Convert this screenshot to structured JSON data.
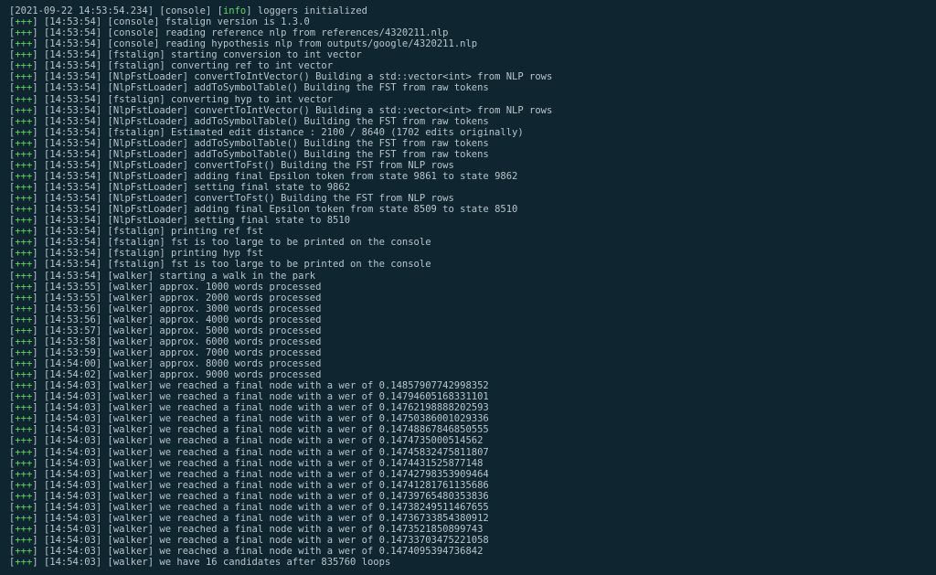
{
  "plus": "+++",
  "info": "info",
  "lines": [
    {
      "p": false,
      "ts": "[2021-09-22 14:53:54.234]",
      "tag": "[console]",
      "msg": "loggers initialized",
      "hasInfo": true
    },
    {
      "p": true,
      "ts": "[14:53:54]",
      "tag": "[console]",
      "msg": "fstalign version is 1.3.0"
    },
    {
      "p": true,
      "ts": "[14:53:54]",
      "tag": "[console]",
      "msg": "reading reference nlp from references/4320211.nlp"
    },
    {
      "p": true,
      "ts": "[14:53:54]",
      "tag": "[console]",
      "msg": "reading hypothesis nlp from outputs/google/4320211.nlp"
    },
    {
      "p": true,
      "ts": "[14:53:54]",
      "tag": "[fstalign]",
      "msg": "starting conversion to int vector"
    },
    {
      "p": true,
      "ts": "[14:53:54]",
      "tag": "[fstalign]",
      "msg": "converting ref to int vector"
    },
    {
      "p": true,
      "ts": "[14:53:54]",
      "tag": "[NlpFstLoader]",
      "msg": "convertToIntVector() Building a std::vector<int> from NLP rows"
    },
    {
      "p": true,
      "ts": "[14:53:54]",
      "tag": "[NlpFstLoader]",
      "msg": "addToSymbolTable() Building the FST from raw tokens"
    },
    {
      "p": true,
      "ts": "[14:53:54]",
      "tag": "[fstalign]",
      "msg": "converting hyp to int vector"
    },
    {
      "p": true,
      "ts": "[14:53:54]",
      "tag": "[NlpFstLoader]",
      "msg": "convertToIntVector() Building a std::vector<int> from NLP rows"
    },
    {
      "p": true,
      "ts": "[14:53:54]",
      "tag": "[NlpFstLoader]",
      "msg": "addToSymbolTable() Building the FST from raw tokens"
    },
    {
      "p": true,
      "ts": "[14:53:54]",
      "tag": "[fstalign]",
      "msg": "Estimated edit distance : 2100 / 8640 (1702 edits originally)"
    },
    {
      "p": true,
      "ts": "[14:53:54]",
      "tag": "[NlpFstLoader]",
      "msg": "addToSymbolTable() Building the FST from raw tokens"
    },
    {
      "p": true,
      "ts": "[14:53:54]",
      "tag": "[NlpFstLoader]",
      "msg": "addToSymbolTable() Building the FST from raw tokens"
    },
    {
      "p": true,
      "ts": "[14:53:54]",
      "tag": "[NlpFstLoader]",
      "msg": "convertToFst() Building the FST from NLP rows"
    },
    {
      "p": true,
      "ts": "[14:53:54]",
      "tag": "[NlpFstLoader]",
      "msg": "adding final Epsilon token from state 9861 to state 9862"
    },
    {
      "p": true,
      "ts": "[14:53:54]",
      "tag": "[NlpFstLoader]",
      "msg": "setting final state to 9862"
    },
    {
      "p": true,
      "ts": "[14:53:54]",
      "tag": "[NlpFstLoader]",
      "msg": "convertToFst() Building the FST from NLP rows"
    },
    {
      "p": true,
      "ts": "[14:53:54]",
      "tag": "[NlpFstLoader]",
      "msg": "adding final Epsilon token from state 8509 to state 8510"
    },
    {
      "p": true,
      "ts": "[14:53:54]",
      "tag": "[NlpFstLoader]",
      "msg": "setting final state to 8510"
    },
    {
      "p": true,
      "ts": "[14:53:54]",
      "tag": "[fstalign]",
      "msg": "printing ref fst"
    },
    {
      "p": true,
      "ts": "[14:53:54]",
      "tag": "[fstalign]",
      "msg": "fst is too large to be printed on the console"
    },
    {
      "p": true,
      "ts": "[14:53:54]",
      "tag": "[fstalign]",
      "msg": "printing hyp fst"
    },
    {
      "p": true,
      "ts": "[14:53:54]",
      "tag": "[fstalign]",
      "msg": "fst is too large to be printed on the console"
    },
    {
      "p": true,
      "ts": "[14:53:54]",
      "tag": "[walker]",
      "msg": "starting a walk in the park"
    },
    {
      "p": true,
      "ts": "[14:53:55]",
      "tag": "[walker]",
      "msg": "approx. 1000 words processed"
    },
    {
      "p": true,
      "ts": "[14:53:55]",
      "tag": "[walker]",
      "msg": "approx. 2000 words processed"
    },
    {
      "p": true,
      "ts": "[14:53:56]",
      "tag": "[walker]",
      "msg": "approx. 3000 words processed"
    },
    {
      "p": true,
      "ts": "[14:53:56]",
      "tag": "[walker]",
      "msg": "approx. 4000 words processed"
    },
    {
      "p": true,
      "ts": "[14:53:57]",
      "tag": "[walker]",
      "msg": "approx. 5000 words processed"
    },
    {
      "p": true,
      "ts": "[14:53:58]",
      "tag": "[walker]",
      "msg": "approx. 6000 words processed"
    },
    {
      "p": true,
      "ts": "[14:53:59]",
      "tag": "[walker]",
      "msg": "approx. 7000 words processed"
    },
    {
      "p": true,
      "ts": "[14:54:00]",
      "tag": "[walker]",
      "msg": "approx. 8000 words processed"
    },
    {
      "p": true,
      "ts": "[14:54:02]",
      "tag": "[walker]",
      "msg": "approx. 9000 words processed"
    },
    {
      "p": true,
      "ts": "[14:54:03]",
      "tag": "[walker]",
      "msg": "we reached a final node with a wer of 0.14857907742998352"
    },
    {
      "p": true,
      "ts": "[14:54:03]",
      "tag": "[walker]",
      "msg": "we reached a final node with a wer of 0.14794605168331101"
    },
    {
      "p": true,
      "ts": "[14:54:03]",
      "tag": "[walker]",
      "msg": "we reached a final node with a wer of 0.14762198888202593"
    },
    {
      "p": true,
      "ts": "[14:54:03]",
      "tag": "[walker]",
      "msg": "we reached a final node with a wer of 0.14750386001029336"
    },
    {
      "p": true,
      "ts": "[14:54:03]",
      "tag": "[walker]",
      "msg": "we reached a final node with a wer of 0.14748867846850555"
    },
    {
      "p": true,
      "ts": "[14:54:03]",
      "tag": "[walker]",
      "msg": "we reached a final node with a wer of 0.1474735000514562"
    },
    {
      "p": true,
      "ts": "[14:54:03]",
      "tag": "[walker]",
      "msg": "we reached a final node with a wer of 0.14745832475811807"
    },
    {
      "p": true,
      "ts": "[14:54:03]",
      "tag": "[walker]",
      "msg": "we reached a final node with a wer of 0.1474431525877148"
    },
    {
      "p": true,
      "ts": "[14:54:03]",
      "tag": "[walker]",
      "msg": "we reached a final node with a wer of 0.14742798353909464"
    },
    {
      "p": true,
      "ts": "[14:54:03]",
      "tag": "[walker]",
      "msg": "we reached a final node with a wer of 0.14741281761135686"
    },
    {
      "p": true,
      "ts": "[14:54:03]",
      "tag": "[walker]",
      "msg": "we reached a final node with a wer of 0.14739765480353836"
    },
    {
      "p": true,
      "ts": "[14:54:03]",
      "tag": "[walker]",
      "msg": "we reached a final node with a wer of 0.14738249511467655"
    },
    {
      "p": true,
      "ts": "[14:54:03]",
      "tag": "[walker]",
      "msg": "we reached a final node with a wer of 0.14736733854380912"
    },
    {
      "p": true,
      "ts": "[14:54:03]",
      "tag": "[walker]",
      "msg": "we reached a final node with a wer of 0.1473521850899743"
    },
    {
      "p": true,
      "ts": "[14:54:03]",
      "tag": "[walker]",
      "msg": "we reached a final node with a wer of 0.14733703475221058"
    },
    {
      "p": true,
      "ts": "[14:54:03]",
      "tag": "[walker]",
      "msg": "we reached a final node with a wer of 0.1474095394736842"
    },
    {
      "p": true,
      "ts": "[14:54:03]",
      "tag": "[walker]",
      "msg": "we have 16 candidates after 835760 loops"
    }
  ]
}
